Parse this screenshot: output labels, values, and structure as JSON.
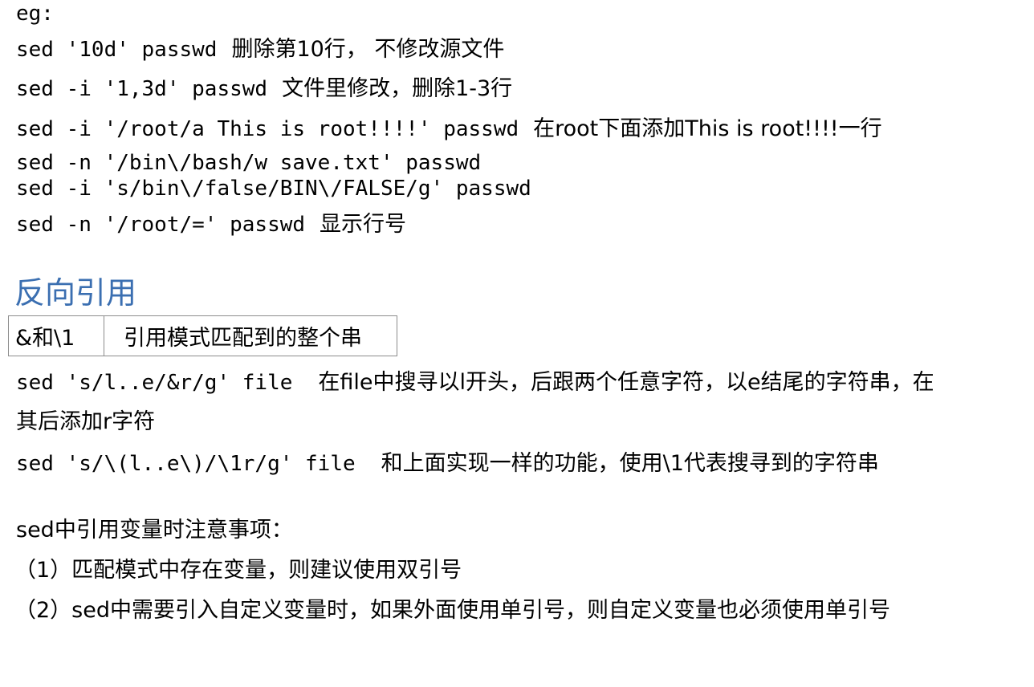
{
  "examples_label": "eg:",
  "examples": [
    {
      "cmd": "sed '10d' passwd",
      "note": "删除第10行， 不修改源文件"
    },
    {
      "cmd": "sed -i '1,3d' passwd",
      "note": "文件里修改，删除1-3行"
    },
    {
      "cmd": "sed -i '/root/a This is root!!!!' passwd",
      "note": "在root下面添加This is root!!!!一行"
    },
    {
      "cmd": "sed -n '/bin\\/bash/w save.txt' passwd",
      "note": ""
    },
    {
      "cmd": "sed -i 's/bin\\/false/BIN\\/FALSE/g' passwd",
      "note": ""
    },
    {
      "cmd": "sed -n '/root/=' passwd",
      "note": "显示行号"
    }
  ],
  "backref": {
    "heading": "反向引用",
    "table": {
      "col1": "&和\\1",
      "col2": "引用模式匹配到的整个串"
    },
    "example1_cmd": "sed 's/l..e/&r/g' file",
    "example1_note_line1": "在file中搜寻以l开头，后跟两个任意字符，以e结尾的字符串，在",
    "example1_note_line2": "其后添加r字符",
    "example2_cmd": "sed 's/\\(l..e\\)/\\1r/g' file",
    "example2_note": "和上面实现一样的功能，使用\\1代表搜寻到的字符串"
  },
  "notes": {
    "title": "sed中引用变量时注意事项：",
    "items": [
      "（1）匹配模式中存在变量，则建议使用双引号",
      "（2）sed中需要引入自定义变量时，如果外面使用单引号，则自定义变量也必须使用单引号"
    ]
  }
}
